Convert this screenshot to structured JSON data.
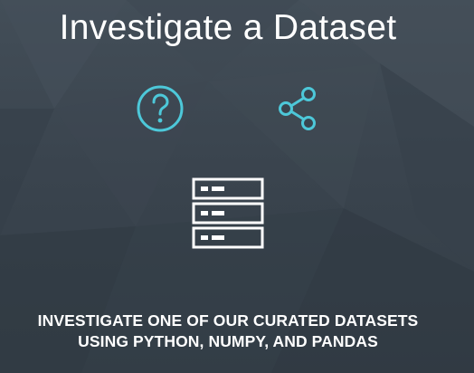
{
  "slide": {
    "title": "Investigate a Dataset",
    "subtitle_line_1": "INVESTIGATE ONE OF OUR CURATED DATASETS",
    "subtitle_line_2": "USING PYTHON, NUMPY, AND PANDAS"
  },
  "icons": {
    "question": "question-circle-icon",
    "share": "share-icon",
    "server": "server-stack-icon"
  },
  "colors": {
    "background": "#39444e",
    "accent": "#4dc8d9",
    "text": "#ffffff"
  }
}
